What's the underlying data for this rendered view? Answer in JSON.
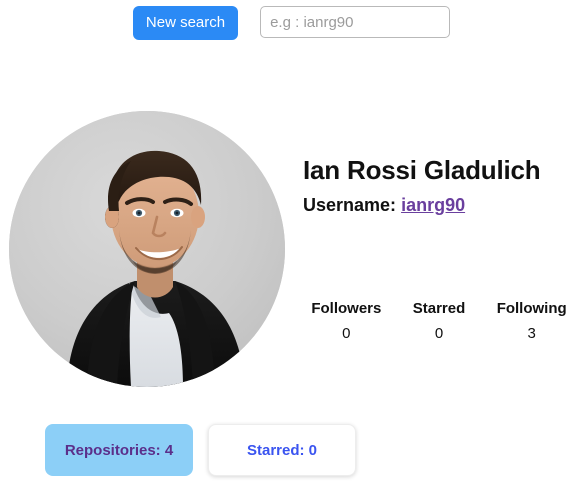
{
  "search": {
    "new_search_label": "New search",
    "input_value": "",
    "input_placeholder": "e.g : ianrg90",
    "button_color": "#2b8af5"
  },
  "profile": {
    "avatar_alt": "user-avatar-photo",
    "full_name": "Ian Rossi Gladulich",
    "username_label": "Username:",
    "username": "ianrg90",
    "username_link_color": "#6a3f9e",
    "stats": [
      {
        "label": "Followers",
        "value": "0"
      },
      {
        "label": "Starred",
        "value": "0"
      },
      {
        "label": "Following",
        "value": "3"
      }
    ]
  },
  "tabs": [
    {
      "label": "Repositories: 4",
      "state": "active",
      "bg": "#8ccff7",
      "color": "#5b2f8a"
    },
    {
      "label": "Starred: 0",
      "state": "inactive",
      "bg": "#ffffff",
      "color": "#3a54f0"
    }
  ]
}
